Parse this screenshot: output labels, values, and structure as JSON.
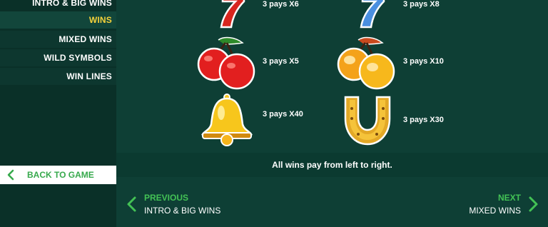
{
  "sidebar": {
    "items": [
      {
        "label": "INTRO & BIG WINS"
      },
      {
        "label": "WINS"
      },
      {
        "label": "MIXED WINS"
      },
      {
        "label": "WILD SYMBOLS"
      },
      {
        "label": "WIN LINES"
      }
    ],
    "active_item": "WINS",
    "back_label": "BACK TO GAME"
  },
  "symbols": [
    {
      "icon": "red-seven-icon",
      "pays": "3 pays X6"
    },
    {
      "icon": "blue-seven-icon",
      "pays": "3 pays X8"
    },
    {
      "icon": "cherry-icon",
      "pays": "3 pays X5"
    },
    {
      "icon": "orange-icon",
      "pays": "3 pays X10"
    },
    {
      "icon": "bell-icon",
      "pays": "3 pays X40"
    },
    {
      "icon": "horseshoe-icon",
      "pays": "3 pays X30"
    }
  ],
  "info_text": "All wins pay from left to right.",
  "nav": {
    "prev_title": "PREVIOUS",
    "prev_sub": "INTRO & BIG WINS",
    "next_title": "NEXT",
    "next_sub": "MIXED WINS"
  },
  "colors": {
    "background": "#0e3f35",
    "sidebar": "#0a3028",
    "active_text": "#f5d23b",
    "accent_green": "#43c255"
  }
}
